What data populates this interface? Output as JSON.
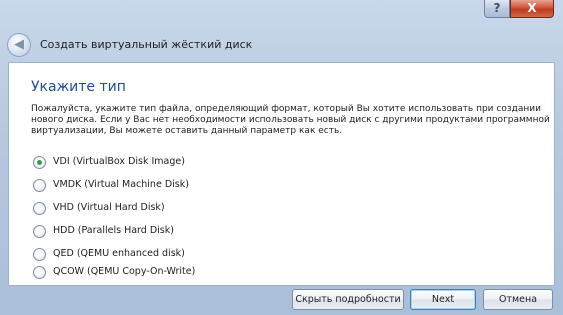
{
  "window": {
    "help_label": "?",
    "close_label": "X"
  },
  "header": {
    "back_glyph": "◀",
    "title": "Создать виртуальный жёсткий диск"
  },
  "page": {
    "title": "Укажите тип",
    "description": "Пожалуйста, укажите тип файла, определяющий формат, который Вы хотите использовать при создании нового диска. Если у Вас нет необходимости использовать новый диск с другими продуктами программной виртуализации, Вы можете оставить данный параметр как есть."
  },
  "options": [
    {
      "label": "VDI (VirtualBox Disk Image)",
      "selected": true
    },
    {
      "label": "VMDK (Virtual Machine Disk)",
      "selected": false
    },
    {
      "label": "VHD (Virtual Hard Disk)",
      "selected": false
    },
    {
      "label": "HDD (Parallels Hard Disk)",
      "selected": false
    },
    {
      "label": "QED (QEMU enhanced disk)",
      "selected": false
    },
    {
      "label": "QCOW (QEMU Copy-On-Write)",
      "selected": false
    }
  ],
  "buttons": {
    "hide_details": "Скрыть подробности",
    "next": "Next",
    "cancel": "Отмена"
  },
  "colors": {
    "title_accent": "#1f4e96",
    "radio_selected": "#33a23a"
  }
}
